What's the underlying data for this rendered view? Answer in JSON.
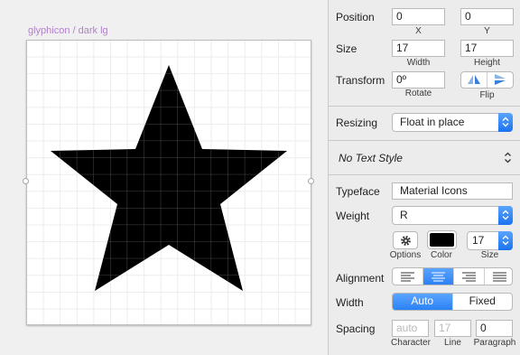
{
  "canvas": {
    "artboard_label": "glyphicon / dark lg"
  },
  "inspector": {
    "position": {
      "label": "Position",
      "x_value": "0",
      "y_value": "0",
      "x_caption": "X",
      "y_caption": "Y"
    },
    "size": {
      "label": "Size",
      "width_value": "17",
      "height_value": "17",
      "width_caption": "Width",
      "height_caption": "Height"
    },
    "transform": {
      "label": "Transform",
      "rotate_value": "0º",
      "rotate_caption": "Rotate",
      "flip_caption": "Flip"
    },
    "resizing": {
      "label": "Resizing",
      "value": "Float in place"
    },
    "text_style": {
      "value": "No Text Style"
    },
    "typeface": {
      "label": "Typeface",
      "value": "Material Icons"
    },
    "weight": {
      "label": "Weight",
      "value": "R"
    },
    "options_caption": "Options",
    "color": {
      "caption": "Color",
      "value": "#000000"
    },
    "font_size": {
      "value": "17",
      "caption": "Size"
    },
    "alignment": {
      "label": "Alignment",
      "options": [
        "left",
        "center",
        "right",
        "justify"
      ],
      "selected": "center"
    },
    "width": {
      "label": "Width",
      "auto_label": "Auto",
      "fixed_label": "Fixed",
      "selected": "Auto"
    },
    "spacing": {
      "label": "Spacing",
      "character_placeholder": "auto",
      "line_placeholder": "17",
      "paragraph_value": "0",
      "character_caption": "Character",
      "line_caption": "Line",
      "paragraph_caption": "Paragraph"
    }
  },
  "colors": {
    "accent": "#2b82f6",
    "artboard_label": "#b080c8",
    "star_fill": "#000000"
  }
}
